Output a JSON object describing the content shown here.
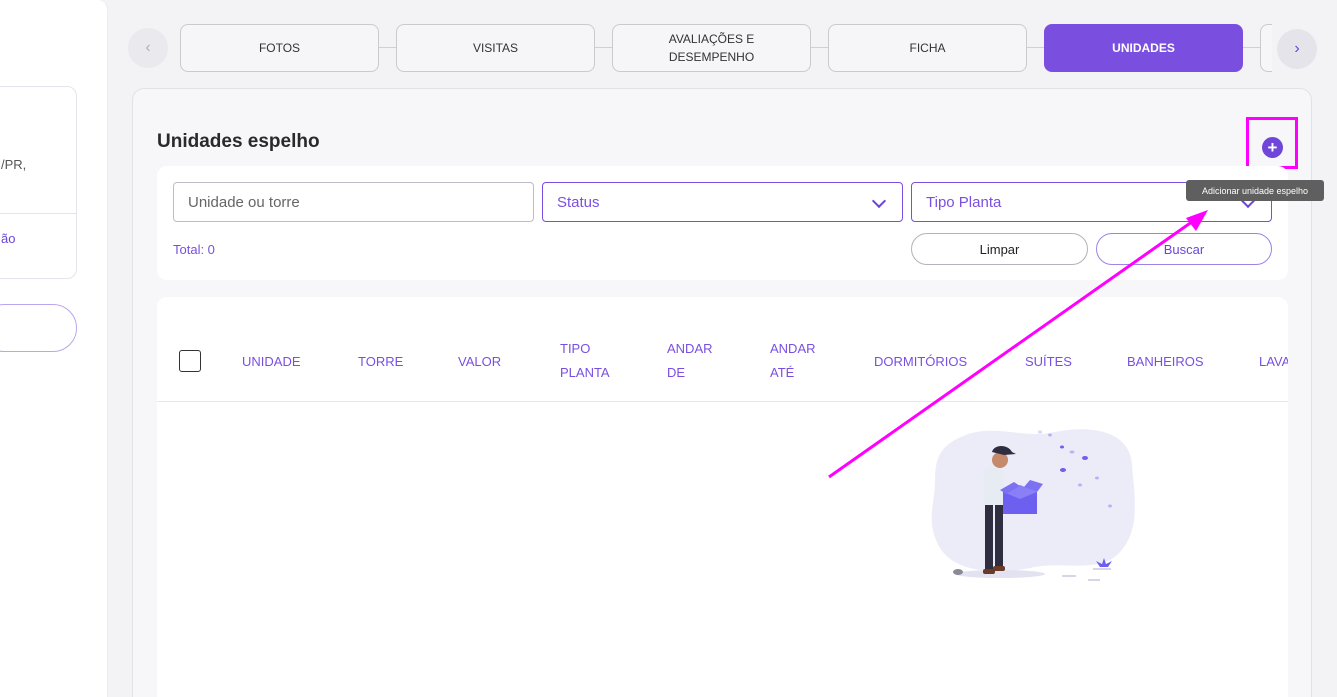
{
  "sidebar": {
    "address_fragment": "/PR,",
    "link_fragment": "ão"
  },
  "tabs": [
    {
      "label": "FOTOS",
      "active": false
    },
    {
      "label": "VISITAS",
      "active": false
    },
    {
      "label": "AVALIAÇÕES E DESEMPENHO",
      "active": false
    },
    {
      "label": "FICHA",
      "active": false
    },
    {
      "label": "UNIDADES",
      "active": true
    }
  ],
  "section": {
    "title": "Unidades espelho",
    "add_tooltip": "Adicionar unidade espelho"
  },
  "filters": {
    "search_placeholder": "Unidade ou torre",
    "status_placeholder": "Status",
    "tipo_placeholder": "Tipo Planta",
    "total": "Total: 0",
    "clear_label": "Limpar",
    "search_label": "Buscar"
  },
  "table": {
    "columns": [
      "UNIDADE",
      "TORRE",
      "VALOR",
      "TIPO PLANTA",
      "ANDAR DE",
      "ANDAR ATÉ",
      "DORMITÓRIOS",
      "SUÍTES",
      "BANHEIROS",
      "LAVA"
    ]
  },
  "icons": {
    "prev": "chevron-left-icon",
    "next": "chevron-right-icon",
    "add": "plus-circle-icon",
    "dropdown": "chevron-down-icon",
    "empty_state": "empty-box-illustration"
  },
  "colors": {
    "accent": "#7a4fe0",
    "annotation": "#ff00ff"
  }
}
